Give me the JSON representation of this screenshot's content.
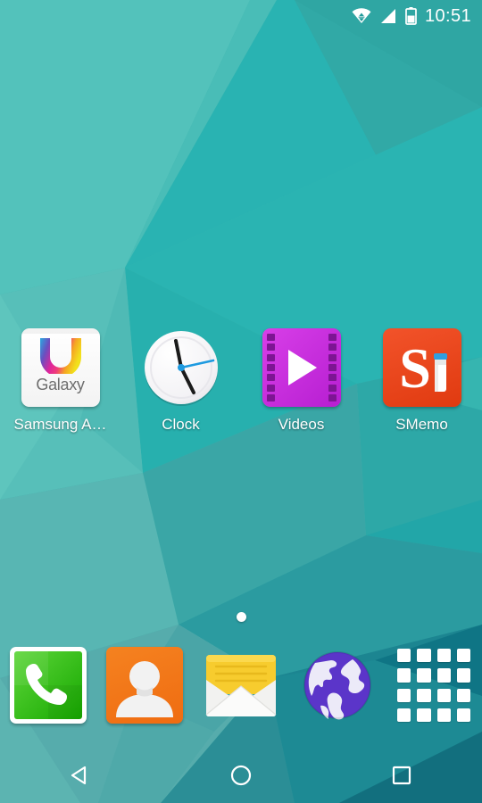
{
  "status_bar": {
    "time": "10:51",
    "icons": [
      {
        "name": "wifi-icon",
        "label": "Wi-Fi connected with data transfer"
      },
      {
        "name": "signal-icon",
        "label": "Mobile signal full"
      },
      {
        "name": "battery-icon",
        "label": "Battery about half"
      }
    ],
    "text_color": "#ffffff"
  },
  "home_screen": {
    "apps": [
      {
        "name": "samsung-apps",
        "label": "Samsung A…",
        "icon": "galaxy-apps-icon"
      },
      {
        "name": "clock",
        "label": "Clock",
        "icon": "clock-icon"
      },
      {
        "name": "videos",
        "label": "Videos",
        "icon": "videos-icon"
      },
      {
        "name": "smemo",
        "label": "SMemo",
        "icon": "smemo-icon"
      }
    ],
    "galaxy": {
      "wordmark": "Galaxy"
    },
    "page_indicator": {
      "pages": 1,
      "current": 1
    }
  },
  "dock": {
    "items": [
      {
        "name": "phone",
        "label": "Phone",
        "icon": "phone-icon",
        "color": "#2bb900"
      },
      {
        "name": "contacts",
        "label": "Contacts",
        "icon": "contacts-icon",
        "color": "#f07318"
      },
      {
        "name": "email",
        "label": "Email",
        "icon": "email-icon",
        "color": "#f5c518"
      },
      {
        "name": "browser",
        "label": "Internet",
        "icon": "browser-icon",
        "color": "#5b35c9"
      },
      {
        "name": "app-drawer",
        "label": "Apps",
        "icon": "apps-grid-icon",
        "color": "#ffffff"
      }
    ]
  },
  "nav_bar": {
    "buttons": [
      {
        "name": "back-button",
        "label": "Back",
        "icon": "triangle-left-icon"
      },
      {
        "name": "home-button",
        "label": "Home",
        "icon": "circle-icon"
      },
      {
        "name": "recents-button",
        "label": "Recents",
        "icon": "square-icon"
      }
    ]
  },
  "wallpaper": {
    "style": "low-poly triangles",
    "colors": [
      "#4fc3bd",
      "#2ab3b0",
      "#31a9a5",
      "#2f9c9c",
      "#3f9fa5",
      "#55b7b4",
      "#1f8f95",
      "#177b86",
      "#0d6e7c",
      "#53a8ad",
      "#6bc0bb"
    ]
  }
}
